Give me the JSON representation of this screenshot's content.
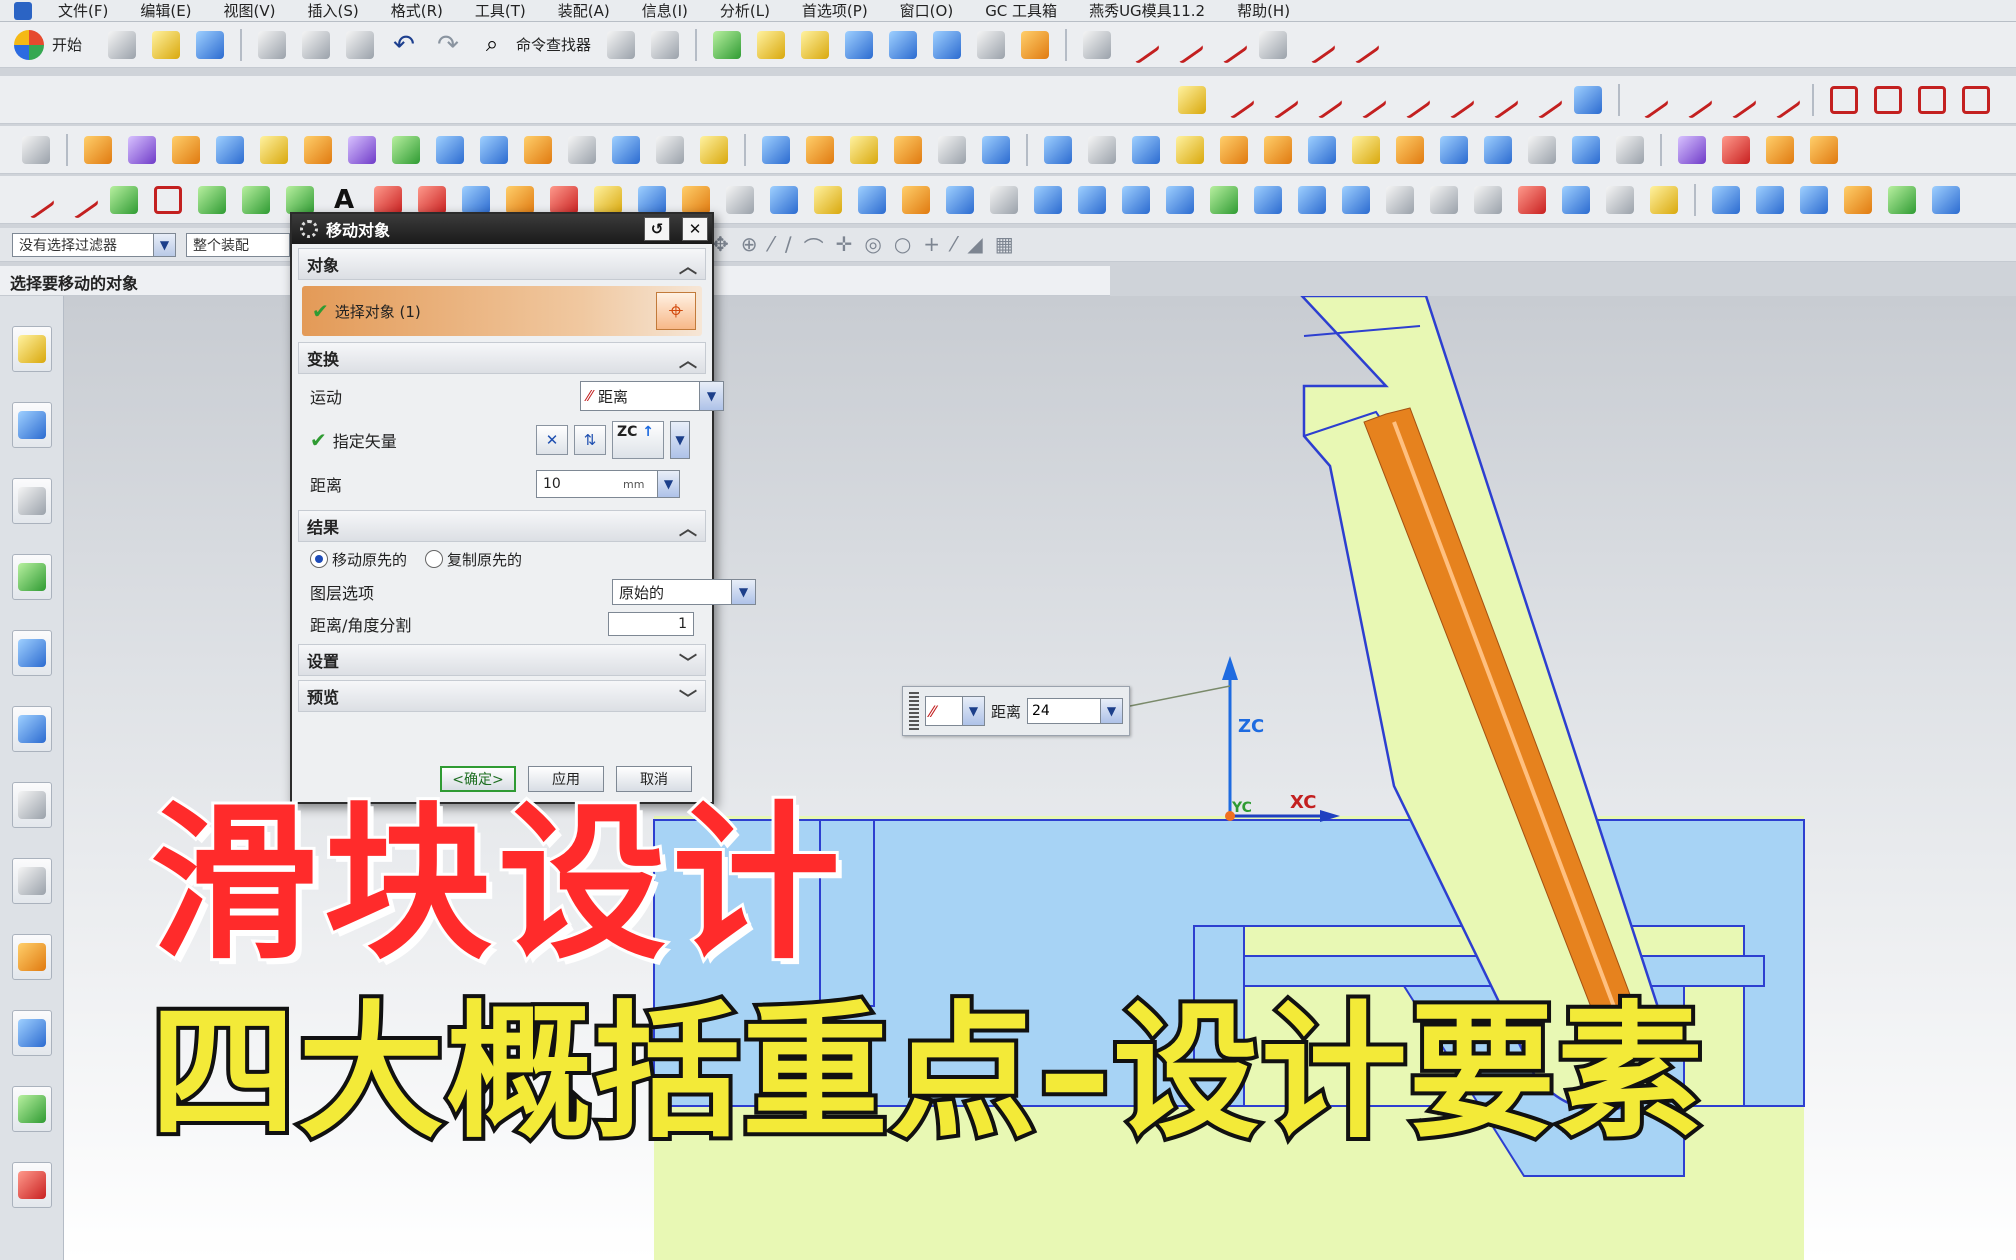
{
  "menubar": {
    "items": [
      "文件(F)",
      "编辑(E)",
      "视图(V)",
      "插入(S)",
      "格式(R)",
      "工具(T)",
      "装配(A)",
      "信息(I)",
      "分析(L)",
      "首选项(P)",
      "窗口(O)",
      "GC 工具箱",
      "燕秀UG模具11.2",
      "帮助(H)"
    ]
  },
  "toolbar": {
    "start_label": "开始",
    "command_finder_label": "命令查找器"
  },
  "filter": {
    "selection_filter": "没有选择过滤器",
    "scope": "整个装配"
  },
  "cue_line": "选择要移动的对象",
  "dialog": {
    "title": "移动对象",
    "object_group": "对象",
    "select_object_label": "选择对象 (1)",
    "transform_group": "变换",
    "motion_label": "运动",
    "motion_value": "距离",
    "vector_label": "指定矢量",
    "vector_value": "ZC",
    "distance_label": "距离",
    "distance_value": "10",
    "distance_unit": "mm",
    "result_group": "结果",
    "move_original": "移动原先的",
    "copy_original": "复制原先的",
    "layer_option_label": "图层选项",
    "layer_option_value": "原始的",
    "divisions_label": "距离/角度分割",
    "divisions_value": "1",
    "settings_group": "设置",
    "preview_group": "预览",
    "ok": "<确定>",
    "apply": "应用",
    "cancel": "取消"
  },
  "onscreen_input": {
    "label": "距离",
    "value": "24"
  },
  "axes": {
    "z": "ZC",
    "x": "XC",
    "y": "YC"
  },
  "overlay": {
    "title": "滑块设计",
    "subtitle": "四大概括重点–设计要素"
  },
  "colors": {
    "part_green": "#e8f8b4",
    "part_blue": "#a7d3f5",
    "pin_orange": "#e6821e",
    "title_red": "#ff2b2b",
    "subtitle_yellow": "#f3ea38"
  }
}
